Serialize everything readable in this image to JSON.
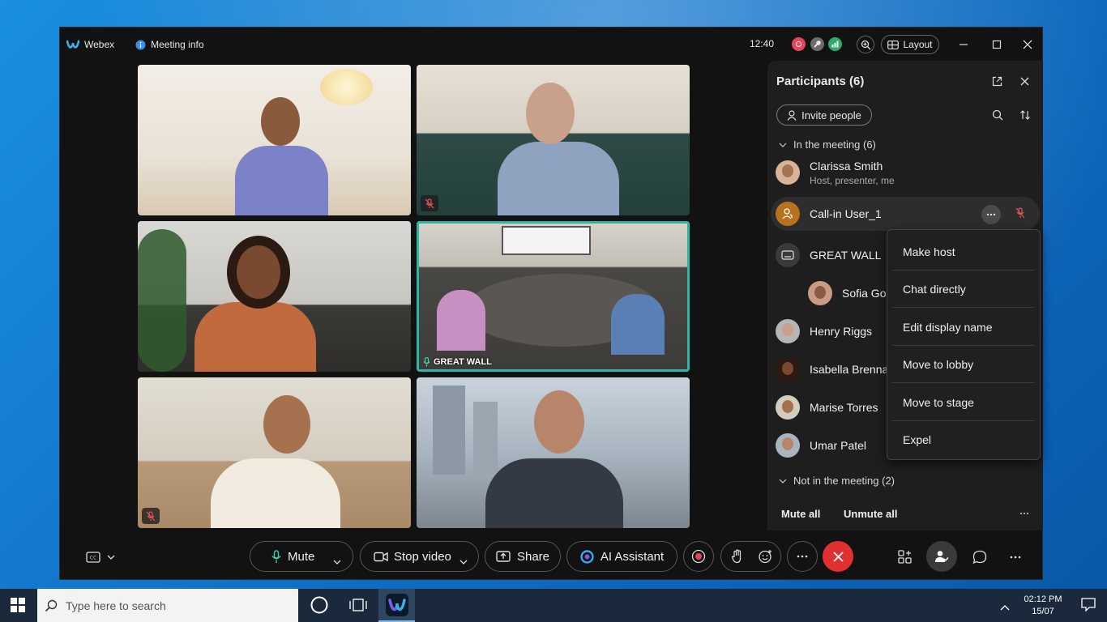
{
  "titlebar": {
    "app_name": "Webex",
    "meeting_info_label": "Meeting info",
    "time": "12:40",
    "layout_label": "Layout"
  },
  "tiles": {
    "great_wall_label": "GREAT WALL"
  },
  "participants_panel": {
    "title": "Participants (6)",
    "invite_label": "Invite people",
    "in_meeting_label": "In the meeting (6)",
    "not_in_meeting_label": "Not in the meeting (2)",
    "mute_all_label": "Mute all",
    "unmute_all_label": "Unmute all",
    "people": [
      {
        "name": "Clarissa Smith",
        "subtitle": "Host, presenter, me"
      },
      {
        "name": "Call-in User_1",
        "subtitle": ""
      },
      {
        "name": "GREAT WALL",
        "subtitle": ""
      },
      {
        "name": "Sofia Go",
        "subtitle": ""
      },
      {
        "name": "Henry Riggs",
        "subtitle": ""
      },
      {
        "name": "Isabella Brenna",
        "subtitle": ""
      },
      {
        "name": "Marise Torres",
        "subtitle": ""
      },
      {
        "name": "Umar Patel",
        "subtitle": ""
      }
    ]
  },
  "context_menu": {
    "items": [
      "Make host",
      "Chat directly",
      "Edit display name",
      "Move to lobby",
      "Move to stage",
      "Expel"
    ]
  },
  "controls": {
    "mute_label": "Mute",
    "stop_video_label": "Stop video",
    "share_label": "Share",
    "ai_assistant_label": "AI Assistant"
  },
  "taskbar": {
    "search_placeholder": "Type here to search",
    "time": "02:12 PM",
    "date": "15/07"
  },
  "colors": {
    "accent_teal": "#2fb5a5",
    "end_call_red": "#e0302f",
    "panel_bg": "#1e1e1e"
  }
}
